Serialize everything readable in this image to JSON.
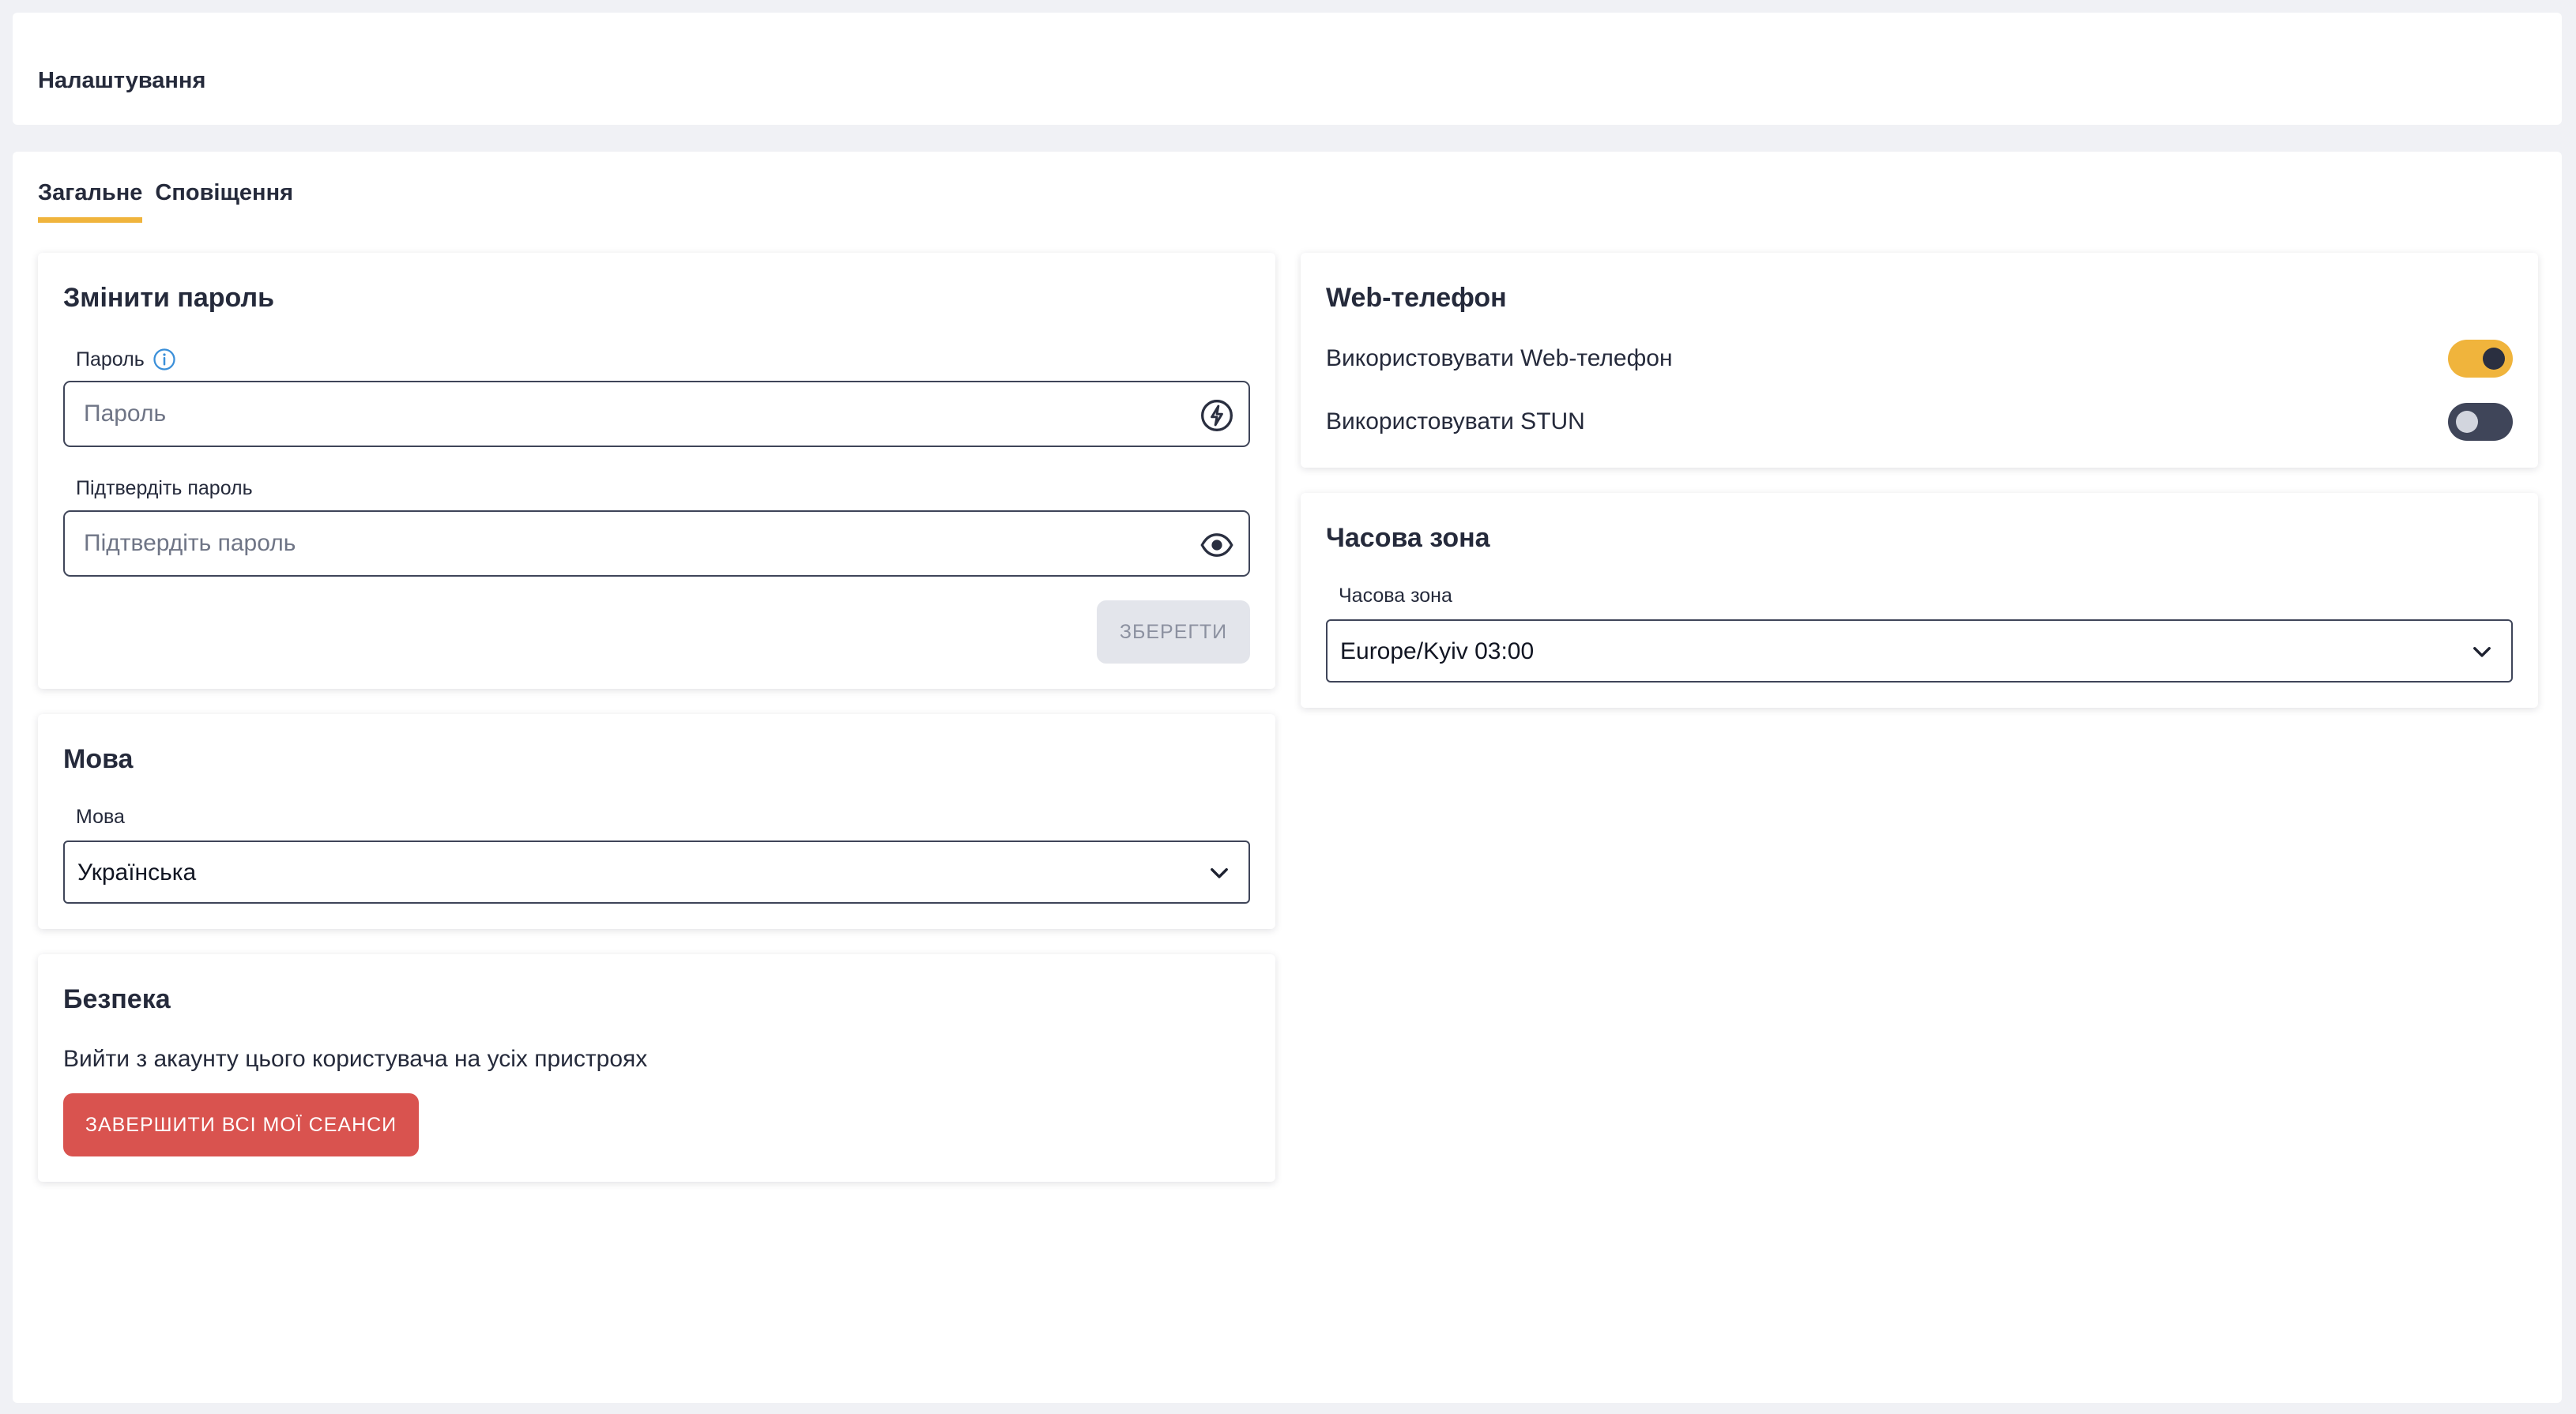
{
  "header": {
    "title": "Налаштування"
  },
  "tabs": [
    {
      "label": "Загальне",
      "active": true
    },
    {
      "label": "Сповіщення",
      "active": false
    }
  ],
  "password_card": {
    "title": "Змінити пароль",
    "password_label": "Пароль",
    "password_placeholder": "Пароль",
    "confirm_label": "Підтвердіть пароль",
    "confirm_placeholder": "Підтвердіть пароль",
    "save_label": "ЗБЕРЕГТИ"
  },
  "language_card": {
    "title": "Мова",
    "field_label": "Мова",
    "selected": "Українська"
  },
  "security_card": {
    "title": "Безпека",
    "description": "Вийти з акаунту цього користувача на усіх пристроях",
    "button_label": "ЗАВЕРШИТИ ВСІ МОЇ СЕАНСИ"
  },
  "webphone_card": {
    "title": "Web-телефон",
    "toggles": [
      {
        "label": "Використовувати Web-телефон",
        "on": true
      },
      {
        "label": "Використовувати STUN",
        "on": false
      }
    ]
  },
  "timezone_card": {
    "title": "Часова зона",
    "field_label": "Часова зона",
    "selected": "Europe/Kyiv 03:00"
  },
  "colors": {
    "accent": "#f0b43c",
    "danger": "#d9534f",
    "toggle_off": "#3f4559",
    "info": "#3a8fd9"
  },
  "icons": {
    "password_info": "info-icon",
    "password_generate": "lightning-icon",
    "confirm_visibility": "eye-icon",
    "select_arrow": "chevron-down-icon"
  }
}
